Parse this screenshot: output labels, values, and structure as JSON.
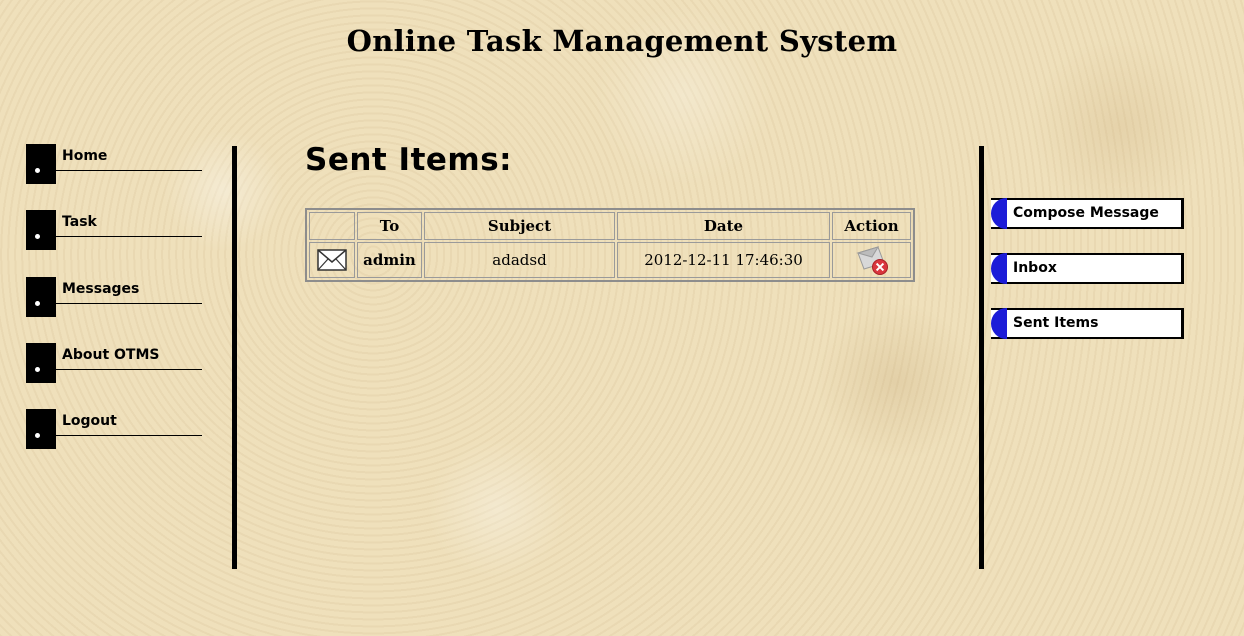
{
  "header": {
    "title": "Online Task Management System"
  },
  "left_nav": {
    "items": [
      {
        "label": "Home"
      },
      {
        "label": "Task"
      },
      {
        "label": "Messages"
      },
      {
        "label": "About OTMS"
      },
      {
        "label": "Logout"
      }
    ]
  },
  "main": {
    "heading": "Sent Items:",
    "table": {
      "columns": [
        "",
        "To",
        "Subject",
        "Date",
        "Action"
      ],
      "rows": [
        {
          "icon": "envelope-icon",
          "to": "admin",
          "subject": "adadsd",
          "date": "2012-12-11 17:46:30",
          "action_icon": "delete-message-icon"
        }
      ]
    }
  },
  "right_nav": {
    "items": [
      {
        "label": "Compose Message"
      },
      {
        "label": "Inbox"
      },
      {
        "label": "Sent Items"
      }
    ]
  },
  "colors": {
    "background": "#efe0bb",
    "tab_cap": "#1c1cd8",
    "delete_red": "#d9363e"
  }
}
